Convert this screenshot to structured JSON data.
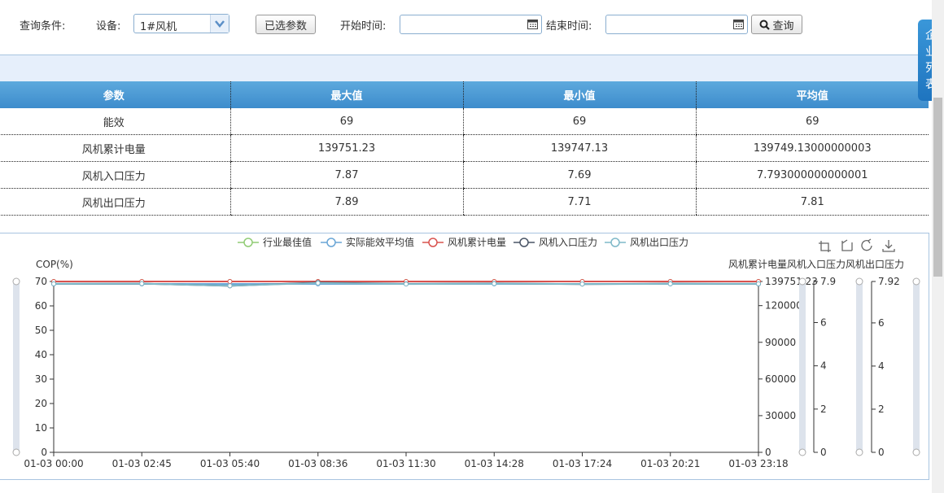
{
  "query": {
    "condition_label": "查询条件:",
    "device_label": "设备:",
    "device_value": "1#风机",
    "params_button": "已选参数",
    "start_label": "开始时间:",
    "start_value": "",
    "end_label": "结束时间:",
    "end_value": "",
    "search_button": "查询"
  },
  "side_tab": {
    "label": "企业列表"
  },
  "table": {
    "headers": [
      "参数",
      "最大值",
      "最小值",
      "平均值"
    ],
    "rows": [
      {
        "name": "能效",
        "max": "69",
        "min": "69",
        "avg": "69"
      },
      {
        "name": "风机累计电量",
        "max": "139751.23",
        "min": "139747.13",
        "avg": "139749.13000000003"
      },
      {
        "name": "风机入口压力",
        "max": "7.87",
        "min": "7.69",
        "avg": "7.793000000000001"
      },
      {
        "name": "风机出口压力",
        "max": "7.89",
        "min": "7.71",
        "avg": "7.81"
      }
    ]
  },
  "colors": {
    "accent": "#3d8ccc",
    "green": "#91cc75",
    "blue": "#6aa6d6",
    "red": "#d9534f",
    "dark": "#4a5566",
    "teal": "#7fb8c8"
  },
  "chart_data": {
    "type": "line",
    "legend": [
      "行业最佳值",
      "实际能效平均值",
      "风机累计电量",
      "风机入口压力",
      "风机出口压力"
    ],
    "y_left_label": "COP(%)",
    "y_right_label": "风机累计电量风机入口压力风机出口压力",
    "x": [
      "01-03 00:00",
      "01-03 02:45",
      "01-03 05:40",
      "01-03 08:36",
      "01-03 11:30",
      "01-03 14:28",
      "01-03 17:24",
      "01-03 20:21",
      "01-03 23:18"
    ],
    "y_left_ticks": [
      "0",
      "10",
      "20",
      "30",
      "40",
      "50",
      "60",
      "70"
    ],
    "y_left_range": [
      0,
      70
    ],
    "y_right1_ticks": [
      "0",
      "30000",
      "60000",
      "90000",
      "120000",
      "139751.23"
    ],
    "y_right1_range": [
      0,
      139751.23
    ],
    "y_right2_ticks": [
      "0",
      "2",
      "4",
      "6",
      "7.9"
    ],
    "y_right2_range": [
      0,
      7.9
    ],
    "y_right3_ticks": [
      "0",
      "2",
      "4",
      "6",
      "7.92"
    ],
    "y_right3_range": [
      0,
      7.92
    ],
    "series": [
      {
        "name": "行业最佳值",
        "color": "#91cc75",
        "values": [
          70,
          70,
          70,
          70,
          70,
          70,
          70,
          70,
          70
        ]
      },
      {
        "name": "实际能效平均值",
        "color": "#6aa6d6",
        "values": [
          69,
          69,
          69,
          69,
          69,
          69,
          69,
          69,
          69
        ]
      },
      {
        "name": "风机累计电量",
        "color": "#d9534f",
        "values": [
          139747.13,
          139748,
          139748.5,
          139749,
          139749.5,
          139750,
          139750.5,
          139751,
          139751.23
        ]
      },
      {
        "name": "风机入口压力",
        "color": "#4a5566",
        "values": [
          7.79,
          7.8,
          7.7,
          7.85,
          7.79,
          7.81,
          7.78,
          7.8,
          7.79
        ]
      },
      {
        "name": "风机出口压力",
        "color": "#7fb8c8",
        "values": [
          7.81,
          7.82,
          7.72,
          7.85,
          7.8,
          7.82,
          7.8,
          7.81,
          7.81
        ]
      }
    ]
  }
}
